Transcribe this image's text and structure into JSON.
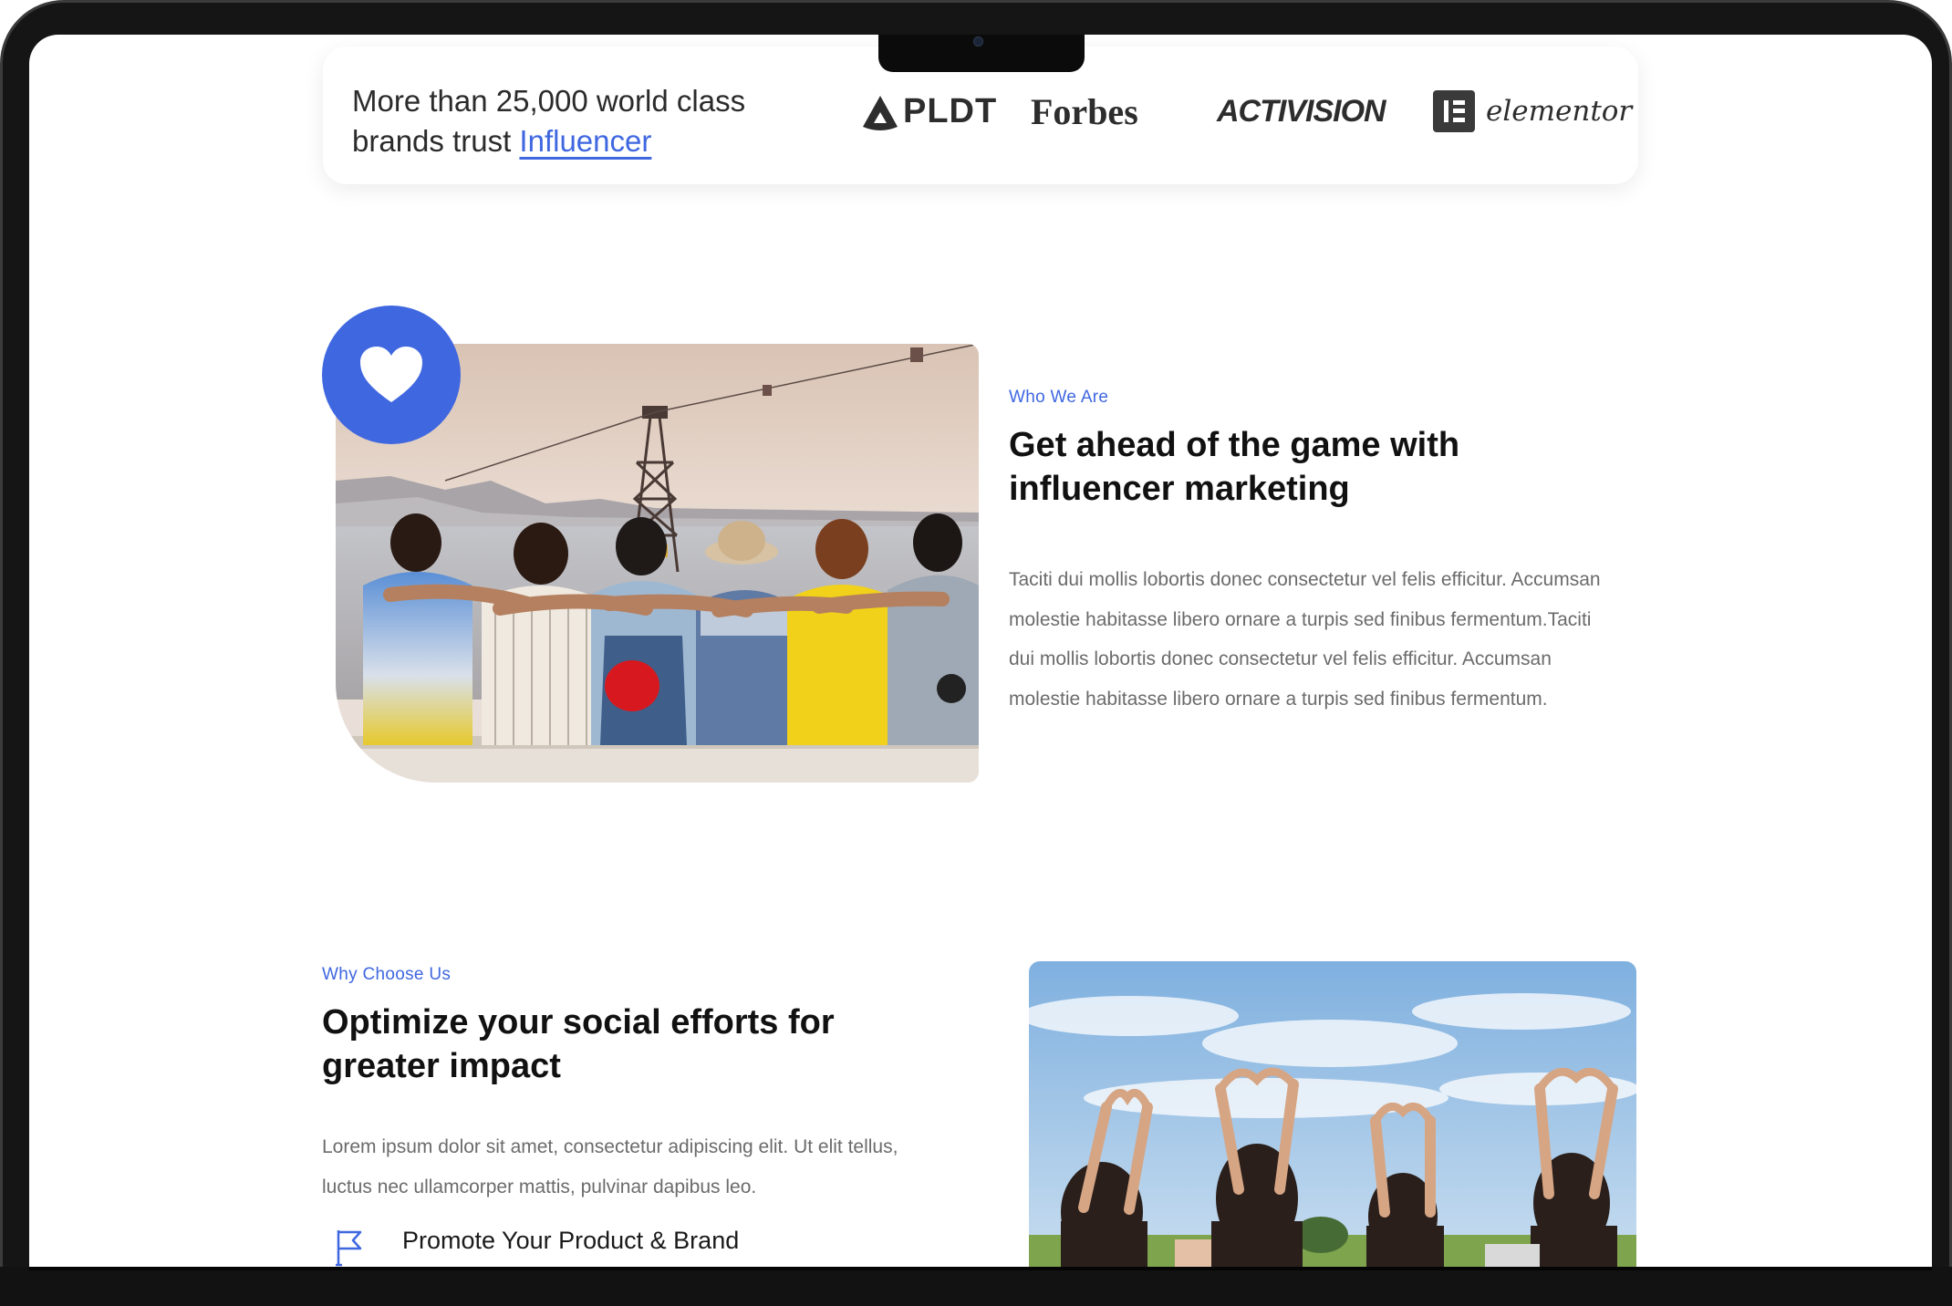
{
  "brands": {
    "text_prefix": "More than 25,000 world class brands trust",
    "link_text": "Influencer",
    "logos": [
      "PLDT",
      "Forbes",
      "ACTIVISION",
      "elementor"
    ]
  },
  "about": {
    "eyebrow": "Who We Are",
    "heading": "Get ahead of the game with influencer marketing",
    "paragraph": "Taciti dui mollis lobortis donec consectetur vel felis efficitur. Accumsan molestie habitasse libero ornare a turpis sed finibus fermentum.Taciti dui mollis lobortis donec consectetur vel felis efficitur. Accumsan molestie habitasse libero ornare a turpis sed finibus fermentum."
  },
  "why": {
    "eyebrow": "Why Choose Us",
    "heading": "Optimize your social efforts for greater impact",
    "paragraph": "Lorem ipsum dolor sit amet, consectetur adipiscing elit. Ut elit tellus, luctus nec ullamcorper mattis, pulvinar dapibus leo.",
    "features": [
      {
        "icon": "flag-icon",
        "label": "Promote Your Product & Brand"
      }
    ]
  },
  "colors": {
    "accent": "#3f67e0",
    "text_dark": "#111111",
    "text_body": "#6b6b6b"
  }
}
